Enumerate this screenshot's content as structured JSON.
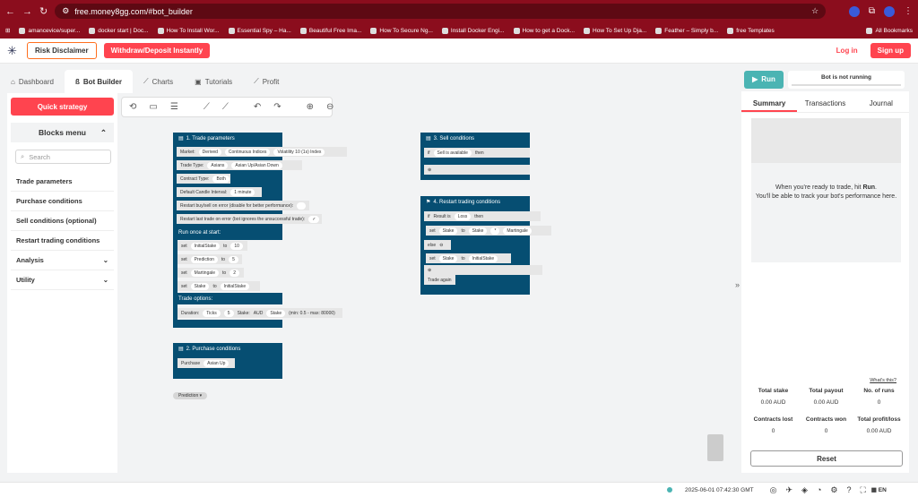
{
  "browser": {
    "url": "free.money8gg.com/#bot_builder",
    "profile": "8",
    "avatar_label": "DH",
    "bookmarks": [
      "amancevice/super...",
      "docker start | Doc...",
      "How To Install Wor...",
      "Essential Spy – Ha...",
      "Beautiful Free Ima...",
      "How To Secure Ng...",
      "Install Docker Engi...",
      "How to get a Dock...",
      "How To Set Up Dja...",
      "Feather – Simply b...",
      "free Templates"
    ],
    "all_bookmarks": "All Bookmarks"
  },
  "appbar": {
    "risk": "Risk Disclaimer",
    "withdraw": "Withdraw/Deposit Instantly",
    "login": "Log in",
    "signup": "Sign up"
  },
  "tabs": [
    {
      "label": "Dashboard",
      "icon": "dashboard-icon"
    },
    {
      "label": "Bot Builder",
      "icon": "bot-icon"
    },
    {
      "label": "Charts",
      "icon": "chart-icon"
    },
    {
      "label": "Tutorials",
      "icon": "tutorial-icon"
    },
    {
      "label": "Profit",
      "icon": "profit-icon"
    }
  ],
  "left": {
    "quick": "Quick strategy",
    "blocks_menu": "Blocks menu",
    "search_placeholder": "Search",
    "items": [
      "Trade parameters",
      "Purchase conditions",
      "Sell conditions (optional)",
      "Restart trading conditions",
      "Analysis",
      "Utility"
    ]
  },
  "blocks": {
    "trade_params": {
      "title": "1. Trade parameters",
      "market_label": "Market:",
      "market_vals": [
        "Derived",
        "Continuous Indices",
        "Volatility 10 (1s) Index"
      ],
      "trade_type_label": "Trade Type:",
      "trade_type_vals": [
        "Asians",
        "Asian Up/Asian Down"
      ],
      "contract_label": "Contract Type:",
      "contract_val": "Both",
      "candle_label": "Default Candle Interval:",
      "candle_val": "1 minute",
      "restart_err": "Restart buy/sell on error (disable for better performance):",
      "restart_last": "Restart last trade on error (bot ignores the unsuccessful trade):",
      "check": "✓",
      "run_once": "Run once at start:",
      "sets": [
        {
          "name": "InitialStake",
          "val": "10"
        },
        {
          "name": "Prediction",
          "val": "5"
        },
        {
          "name": "Martingale",
          "val": "2"
        },
        {
          "name": "Stake",
          "val": "InitialStake"
        }
      ],
      "set_word": "set",
      "to_word": "to",
      "trade_options": "Trade options:",
      "duration_label": "Duration:",
      "duration_unit": "Ticks",
      "duration_val": "5",
      "stake_label": "Stake:",
      "currency": "AUD",
      "stake_var": "Stake",
      "range": "(min: 0.5 - max: 80000)"
    },
    "purchase": {
      "title": "2. Purchase conditions",
      "label": "Purchase",
      "val": "Asian Up"
    },
    "floating": "Prediction",
    "sell": {
      "title": "3. Sell conditions",
      "if": "if",
      "cond": "Sell is available",
      "then": "then"
    },
    "restart": {
      "title": "4. Restart trading conditions",
      "if": "if",
      "result": "Result is",
      "result_val": "Loss",
      "then": "then",
      "set_word": "set",
      "stake": "Stake",
      "to": "to",
      "op": "*",
      "mart": "Martingale",
      "else": "else",
      "init": "InitialStake",
      "trade_again": "Trade again"
    }
  },
  "right": {
    "run": "Run",
    "status": "Bot is not running",
    "tabs": [
      "Summary",
      "Transactions",
      "Journal"
    ],
    "msg_pre": "When you're ready to trade, hit",
    "msg_bold": "Run",
    "msg_post": "You'll be able to track your bot's performance here.",
    "whats": "What's this?",
    "stats": [
      {
        "label": "Total stake",
        "value": "0.00 AUD"
      },
      {
        "label": "Total payout",
        "value": "0.00 AUD"
      },
      {
        "label": "No. of runs",
        "value": "0"
      },
      {
        "label": "Contracts lost",
        "value": "0"
      },
      {
        "label": "Contracts won",
        "value": "0"
      },
      {
        "label": "Total profit/loss",
        "value": "0.00 AUD"
      }
    ],
    "reset": "Reset"
  },
  "footer": {
    "time": "2025-06-01 07:42:30 GMT",
    "lang": "EN"
  }
}
